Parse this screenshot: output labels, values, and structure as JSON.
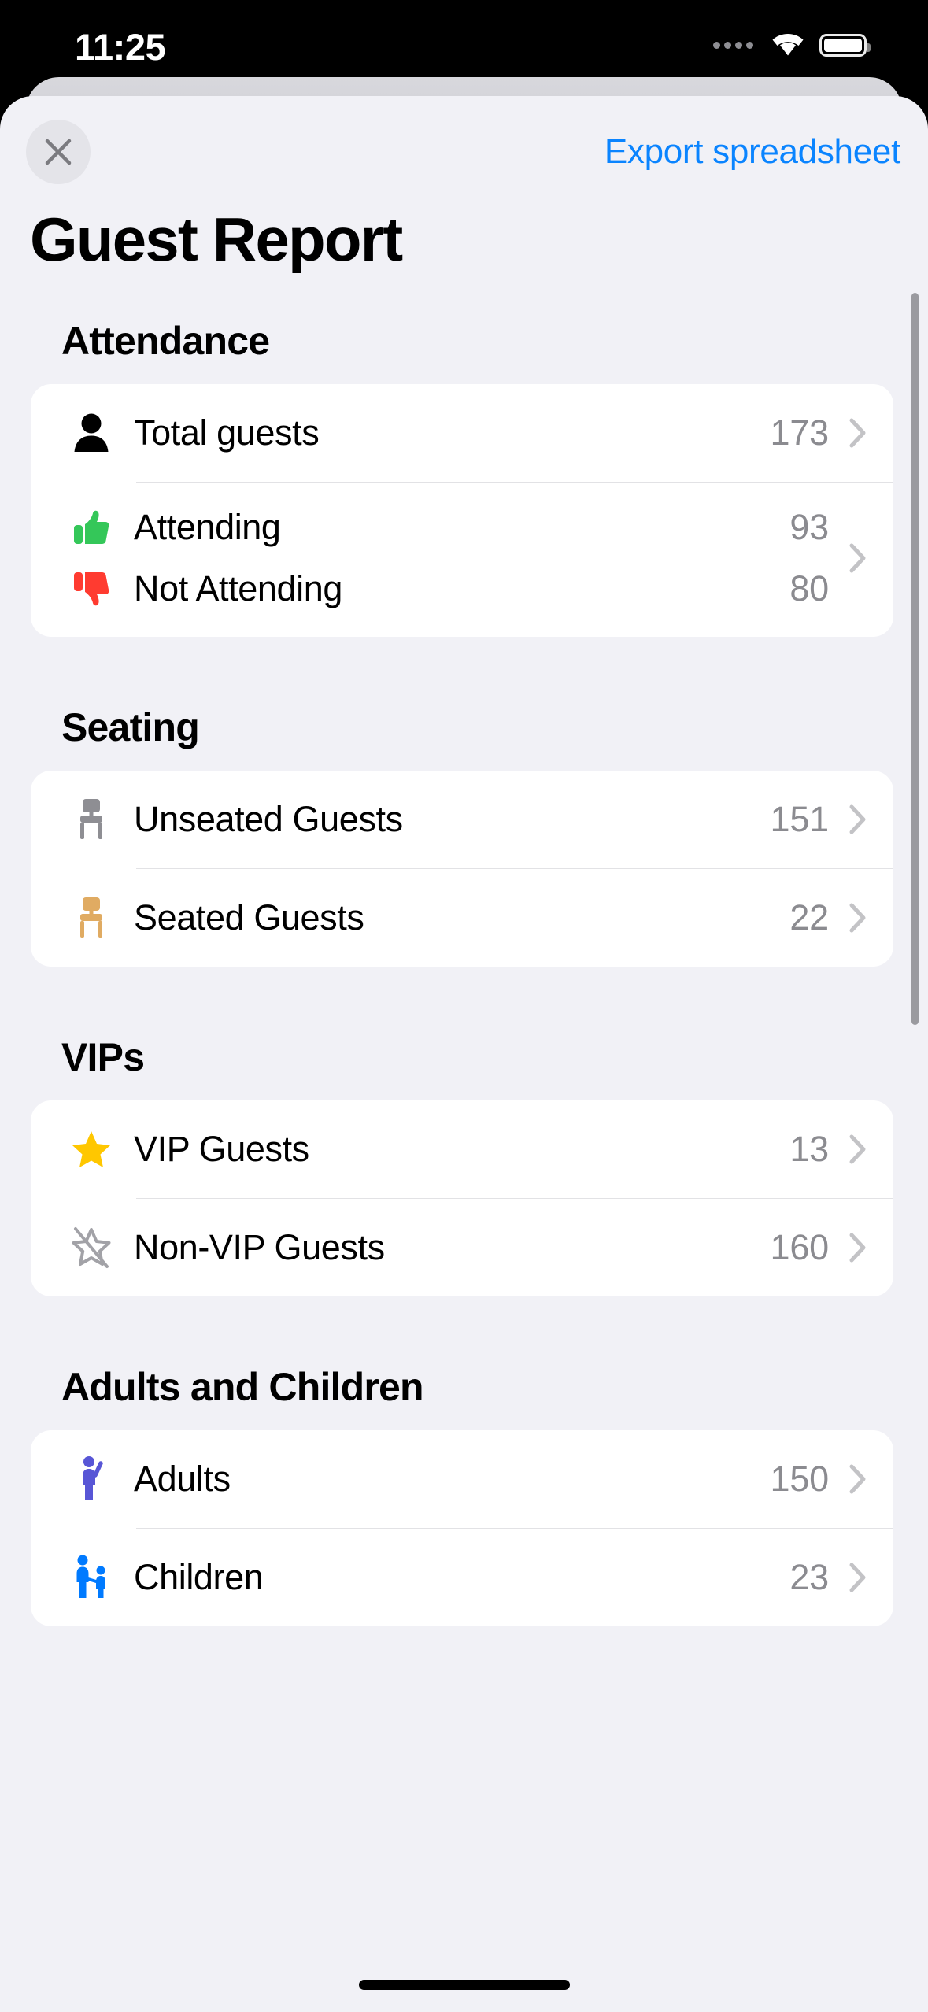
{
  "status_bar": {
    "time": "11:25",
    "signal_icon": "signal-dots-icon",
    "wifi_icon": "wifi-icon",
    "battery_icon": "battery-icon"
  },
  "sheet": {
    "close_icon": "close-icon",
    "export_label": "Export spreadsheet",
    "title": "Guest Report"
  },
  "sections": [
    {
      "title": "Attendance",
      "rows": [
        {
          "icon": "person-icon",
          "label": "Total guests",
          "value": "173"
        }
      ],
      "dual_row": {
        "top": {
          "icon": "thumbs-up-icon",
          "label": "Attending",
          "value": "93"
        },
        "bottom": {
          "icon": "thumbs-down-icon",
          "label": "Not Attending",
          "value": "80"
        }
      }
    },
    {
      "title": "Seating",
      "rows": [
        {
          "icon": "chair-gray-icon",
          "label": "Unseated Guests",
          "value": "151"
        },
        {
          "icon": "chair-wood-icon",
          "label": "Seated Guests",
          "value": "22"
        }
      ]
    },
    {
      "title": "VIPs",
      "rows": [
        {
          "icon": "star-filled-icon",
          "label": "VIP Guests",
          "value": "13"
        },
        {
          "icon": "star-slash-icon",
          "label": "Non-VIP Guests",
          "value": "160"
        }
      ]
    },
    {
      "title": "Adults and Children",
      "rows": [
        {
          "icon": "adult-icon",
          "label": "Adults",
          "value": "150"
        },
        {
          "icon": "adult-child-icon",
          "label": "Children",
          "value": "23"
        }
      ]
    }
  ],
  "colors": {
    "accent_blue": "#0a84ff",
    "attending_green": "#34c759",
    "not_attending_red": "#ff3b30",
    "vip_yellow": "#ffc700",
    "chair_wood": "#e0ab62",
    "chair_gray": "#8e8e93",
    "adult_purple": "#5856d6",
    "child_blue": "#007aff",
    "sheet_background": "#f1f1f6",
    "card_background": "#ffffff",
    "value_gray": "#8b8b90"
  }
}
